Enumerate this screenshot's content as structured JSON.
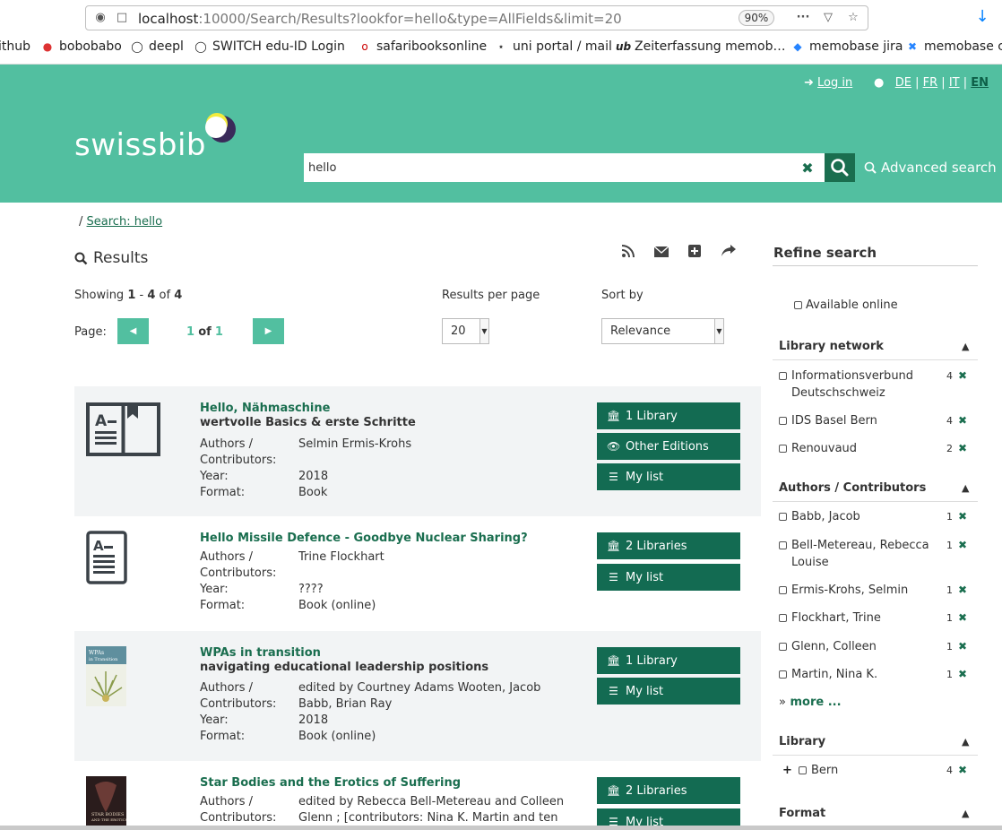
{
  "browser": {
    "url_host": "localhost",
    "url_rest": ":10000/Search/Results?lookfor=hello&type=AllFields&limit=20",
    "zoom": "90%",
    "bookmarks": [
      "ithub",
      "bobobabo",
      "deepl",
      "SWITCH edu-ID Login",
      "safaribooksonline",
      "uni portal / mail",
      "Zeiterfassung memob…",
      "memobase jira",
      "memobase co"
    ]
  },
  "header": {
    "logo": "swissbib",
    "login": "Log in",
    "languages": [
      "DE",
      "FR",
      "IT",
      "EN"
    ],
    "search_value": "hello",
    "advanced_search": "Advanced search"
  },
  "breadcrumb": {
    "sep": "/",
    "link": "Search: hello"
  },
  "results": {
    "title": "Results",
    "showing_prefix": "Showing",
    "showing_from": "1",
    "showing_to": "4",
    "showing_of": "of",
    "showing_total": "4",
    "results_per_page_label": "Results per page",
    "results_per_page_value": "20",
    "sort_label": "Sort by",
    "sort_value": "Relevance",
    "page_label": "Page:",
    "page_current": "1",
    "page_of": "of",
    "page_total": "1"
  },
  "labels": {
    "authors": "Authors /",
    "contributors": "Contributors:",
    "year": "Year:",
    "format": "Format:"
  },
  "records": [
    {
      "title": "Hello, Nähmaschine",
      "subtitle": "wertvolle Basics & erste Schritte",
      "authors": "Selmin Ermis-Krohs",
      "year": "2018",
      "format": "Book",
      "buttons": [
        "1 Library",
        "Other Editions",
        "My list"
      ]
    },
    {
      "title": "Hello Missile Defence - Goodbye Nuclear Sharing?",
      "subtitle": "",
      "authors": "Trine Flockhart",
      "year": "????",
      "format": "Book (online)",
      "buttons": [
        "2 Libraries",
        "My list"
      ]
    },
    {
      "title": "WPAs in transition",
      "subtitle": "navigating educational leadership positions",
      "authors": "edited by Courtney Adams Wooten, Jacob Babb, Brian Ray",
      "year": "2018",
      "format": "Book (online)",
      "buttons": [
        "1 Library",
        "My list"
      ]
    },
    {
      "title": "Star Bodies and the Erotics of Suffering",
      "subtitle": "",
      "authors": "edited by Rebecca Bell-Metereau and Colleen Glenn ; [contributors: Nina K. Martin and ten others]",
      "year": "",
      "format": "",
      "buttons": [
        "2 Libraries",
        "My list"
      ]
    }
  ],
  "sidebar": {
    "title": "Refine search",
    "available_online": "Available online",
    "library_network": {
      "title": "Library network",
      "items": [
        {
          "label": "Informationsverbund Deutschschweiz",
          "count": "4"
        },
        {
          "label": "IDS Basel Bern",
          "count": "4"
        },
        {
          "label": "Renouvaud",
          "count": "2"
        }
      ]
    },
    "authors": {
      "title": "Authors / Contributors",
      "items": [
        {
          "label": "Babb, Jacob",
          "count": "1"
        },
        {
          "label": "Bell-Metereau, Rebecca Louise",
          "count": "1"
        },
        {
          "label": "Ermis-Krohs, Selmin",
          "count": "1"
        },
        {
          "label": "Flockhart, Trine",
          "count": "1"
        },
        {
          "label": "Glenn, Colleen",
          "count": "1"
        },
        {
          "label": "Martin, Nina K.",
          "count": "1"
        }
      ],
      "more_prefix": "»",
      "more": "more ..."
    },
    "library": {
      "title": "Library",
      "items": [
        {
          "label": "Bern",
          "count": "4"
        }
      ]
    },
    "format": {
      "title": "Format"
    }
  },
  "colors": {
    "brand": "#52bfa0",
    "dark_green": "#136b52",
    "link": "#1a6e4f"
  }
}
